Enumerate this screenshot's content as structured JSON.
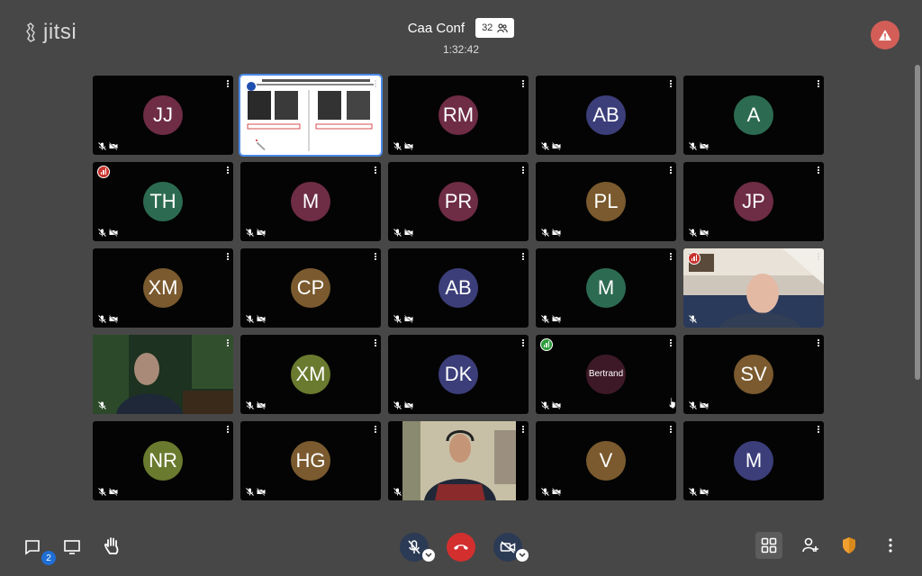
{
  "app": {
    "logo_text": "jitsi"
  },
  "header": {
    "title": "Caa Conf",
    "participant_count": "32",
    "timer": "1:32:42"
  },
  "colors": {
    "background": "#474747",
    "tile": "#040404",
    "hangup": "#d32f2f",
    "warning": "#d35e58",
    "badge": "#1f6fd6",
    "shield": "#f0a030"
  },
  "tiles": [
    {
      "initials": "JJ",
      "color": "#6e2c45"
    },
    {
      "initials": "",
      "type": "screenshare"
    },
    {
      "initials": "RM",
      "color": "#6e2c45"
    },
    {
      "initials": "AB",
      "color": "#3c3e7a"
    },
    {
      "initials": "A",
      "color": "#2c6b52"
    },
    {
      "initials": "TH",
      "color": "#2c6b52",
      "signal": "red"
    },
    {
      "initials": "M",
      "color": "#6e2c45"
    },
    {
      "initials": "PR",
      "color": "#6e2c45"
    },
    {
      "initials": "PL",
      "color": "#7a5a2e"
    },
    {
      "initials": "JP",
      "color": "#6e2c45"
    },
    {
      "initials": "XM",
      "color": "#7a5a2e"
    },
    {
      "initials": "CP",
      "color": "#7a5a2e"
    },
    {
      "initials": "AB",
      "color": "#3c3e7a"
    },
    {
      "initials": "M",
      "color": "#2c6b52"
    },
    {
      "initials": "",
      "type": "video-elderly",
      "signal": "red"
    },
    {
      "initials": "",
      "type": "video-man-forest"
    },
    {
      "initials": "XM",
      "color": "#6a7a2e"
    },
    {
      "initials": "DK",
      "color": "#3c3e7a"
    },
    {
      "initials": "",
      "type": "speaking",
      "name": "Bertrand",
      "color": "#6e2c45",
      "signal": "green"
    },
    {
      "initials": "SV",
      "color": "#7a5a2e"
    },
    {
      "initials": "NR",
      "color": "#6a7a2e"
    },
    {
      "initials": "HG",
      "color": "#7a5a2e"
    },
    {
      "initials": "",
      "type": "video-headset"
    },
    {
      "initials": "V",
      "color": "#7a5a2e"
    },
    {
      "initials": "M",
      "color": "#3c3e7a"
    }
  ],
  "toolbar": {
    "chat_badge": "2"
  }
}
